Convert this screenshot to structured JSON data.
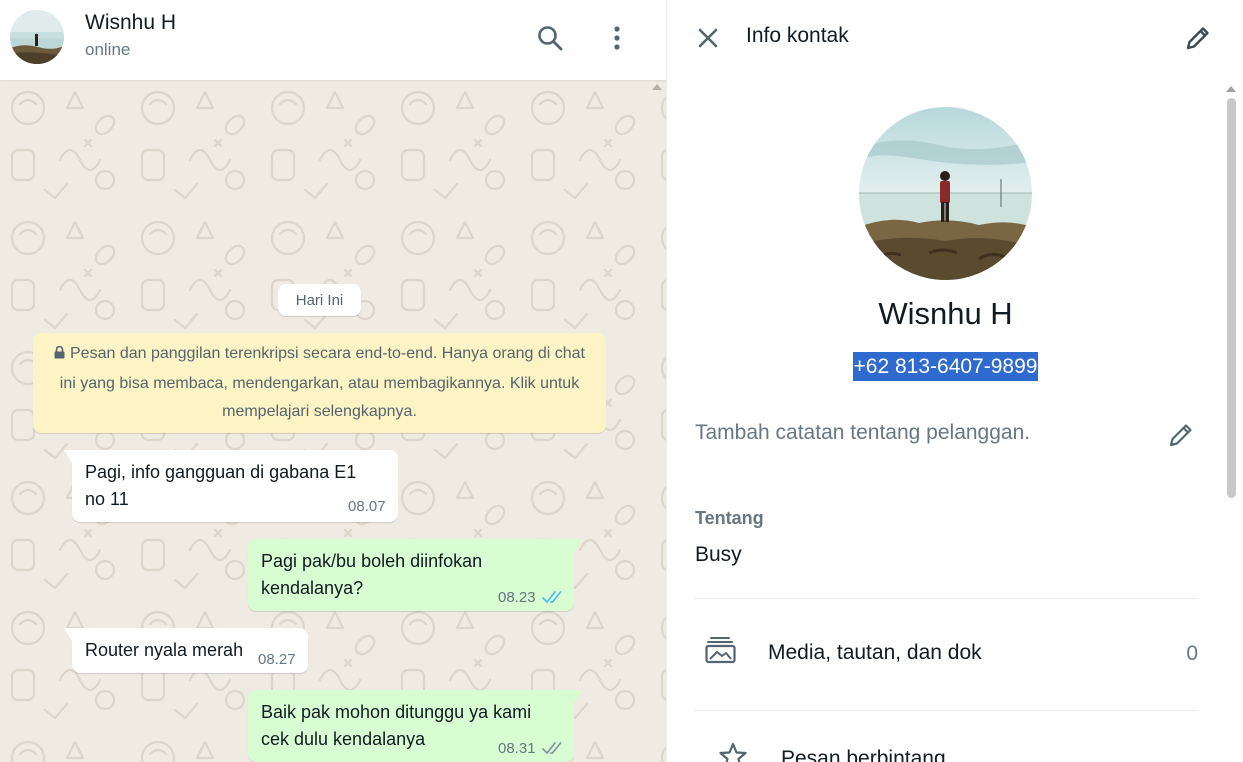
{
  "chat_header": {
    "name": "Wisnhu H",
    "status": "online"
  },
  "chat": {
    "date_chip": "Hari Ini",
    "encryption_notice": "Pesan dan panggilan terenkripsi secara end-to-end. Hanya orang di chat ini yang bisa membaca, mendengarkan, atau membagikannya. Klik untuk mempelajari selengkapnya.",
    "messages": [
      {
        "direction": "in",
        "lines": [
          "Pagi, info gangguan di gabana E1",
          "no 11"
        ],
        "time": "08.07"
      },
      {
        "direction": "out",
        "lines": [
          "Pagi pak/bu boleh diinfokan",
          "kendalanya?"
        ],
        "time": "08.23",
        "status": "read"
      },
      {
        "direction": "in",
        "lines": [
          "Router nyala merah"
        ],
        "time": "08.27"
      },
      {
        "direction": "out",
        "lines": [
          "Baik pak mohon ditunggu ya kami",
          "cek dulu kendalanya"
        ],
        "time": "08.31",
        "status": "delivered"
      }
    ]
  },
  "info": {
    "title": "Info kontak",
    "name": "Wisnhu H",
    "phone": "+62 813-6407-9899",
    "note_placeholder": "Tambah catatan tentang pelanggan.",
    "about_label": "Tentang",
    "about_value": "Busy",
    "media_label": "Media, tautan, dan dok",
    "media_count": "0",
    "starred_label": "Pesan berbintang"
  },
  "icons": {
    "search": "search-icon",
    "menu": "kebab-menu-icon",
    "close": "close-icon",
    "edit": "pencil-icon",
    "lock": "lock-icon",
    "read_ticks": "double-check-icon",
    "media": "media-gallery-icon",
    "star": "star-icon"
  },
  "colors": {
    "read_tick": "#53bdeb",
    "delivered_tick": "#8696a0",
    "outgoing_bubble": "#d9fdd3",
    "notice_bg": "#fdf4c5",
    "selection": "#2f6bce"
  }
}
